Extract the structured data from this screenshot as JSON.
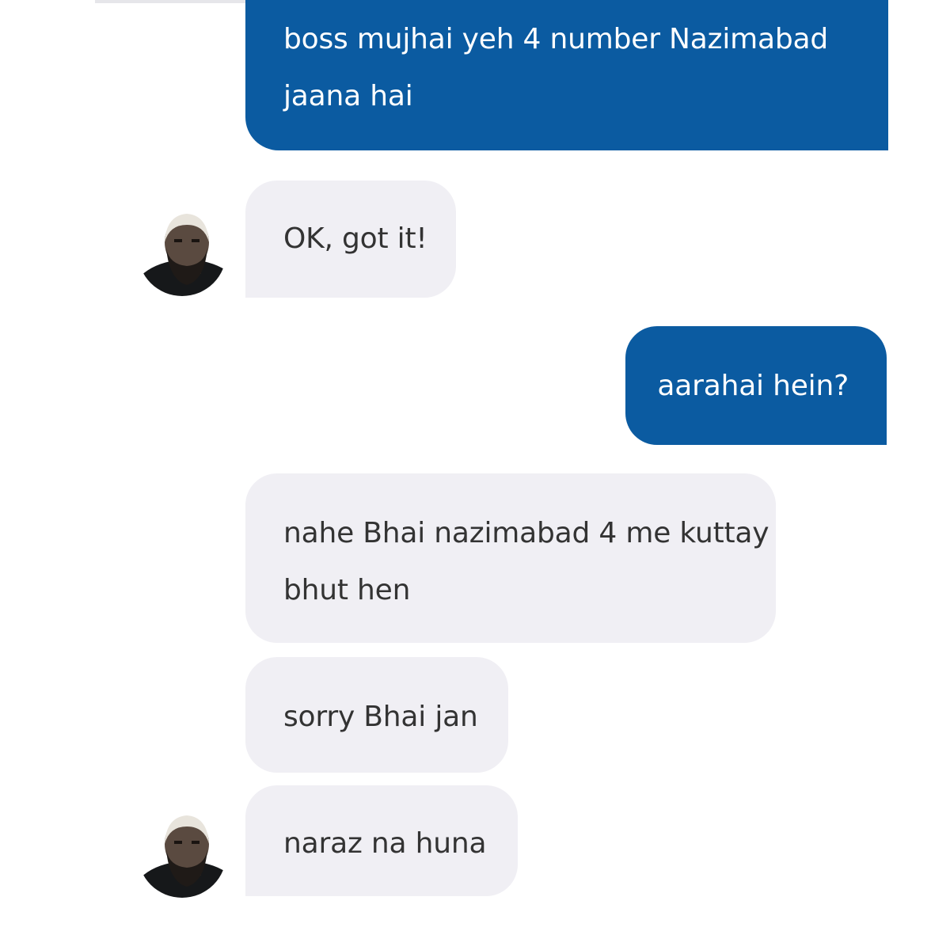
{
  "conversation": {
    "messages": [
      {
        "sender": "me",
        "text": "boss mujhai yeh 4 number Nazimabad jaana hai"
      },
      {
        "sender": "driver",
        "text": "OK, got it!"
      },
      {
        "sender": "me",
        "text": "aarahai hein?"
      },
      {
        "sender": "driver",
        "text": "nahe Bhai nazimabad 4 me kuttay bhut hen"
      },
      {
        "sender": "driver",
        "text": "sorry Bhai jan"
      },
      {
        "sender": "driver",
        "text": "naraz na huna"
      }
    ]
  },
  "colors": {
    "sent_bubble": "#0b5ba1",
    "sent_text": "#ffffff",
    "received_bubble": "#f0eff4",
    "received_text": "#333333",
    "background": "#ffffff"
  },
  "icons": {
    "avatar": "driver-avatar-icon"
  }
}
